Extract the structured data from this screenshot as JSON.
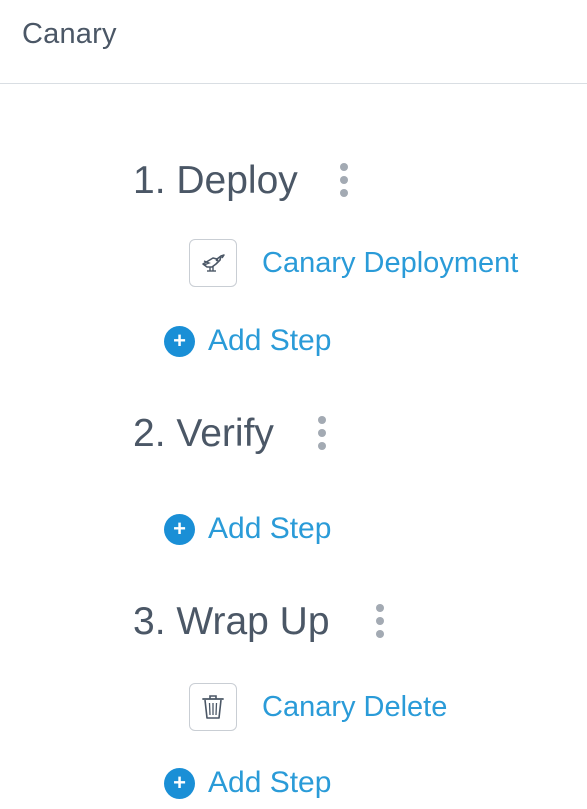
{
  "header": {
    "title": "Canary"
  },
  "sections": [
    {
      "heading": "1. Deploy",
      "steps": [
        {
          "name": "Canary Deployment",
          "icon": "canary-bird-icon"
        }
      ],
      "add_step_label": "Add Step"
    },
    {
      "heading": "2. Verify",
      "steps": [],
      "add_step_label": "Add Step"
    },
    {
      "heading": "3. Wrap Up",
      "steps": [
        {
          "name": "Canary Delete",
          "icon": "trash-icon"
        }
      ],
      "add_step_label": "Add Step"
    }
  ],
  "icons": {
    "add": "+"
  },
  "colors": {
    "heading_text": "#4b5766",
    "link_blue": "#2a9bd8",
    "add_button_blue": "#1a8fd6",
    "kebab_gray": "#a3aab3",
    "divider": "#d9dee3"
  }
}
